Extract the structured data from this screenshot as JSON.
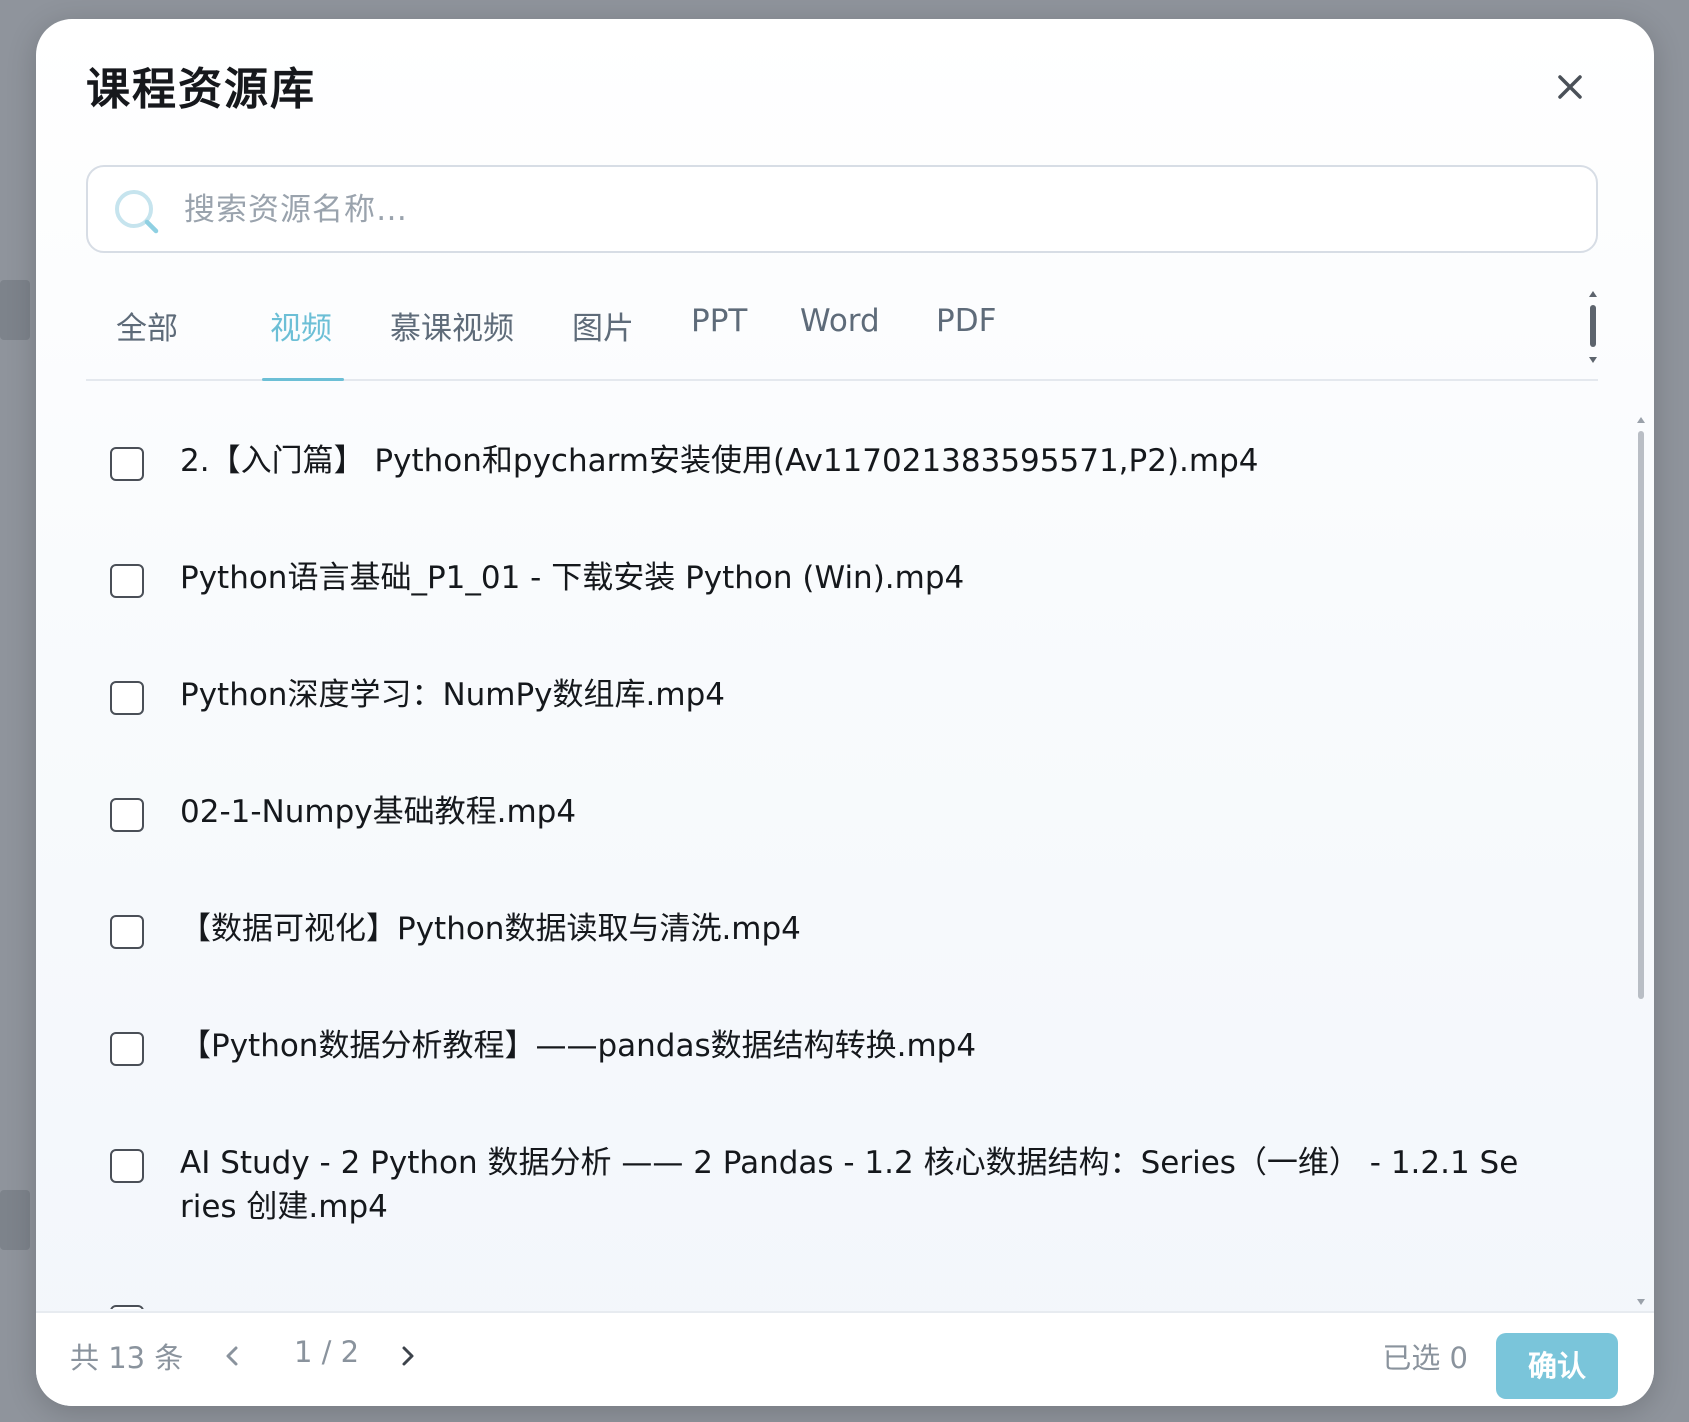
{
  "dialog": {
    "title": "课程资源库"
  },
  "search": {
    "placeholder": "搜索资源名称…"
  },
  "tabs": [
    {
      "label": "全部",
      "active": false
    },
    {
      "label": "视频",
      "active": true
    },
    {
      "label": "慕课视频",
      "active": false
    },
    {
      "label": "图片",
      "active": false
    },
    {
      "label": "PPT",
      "active": false
    },
    {
      "label": "Word",
      "active": false
    },
    {
      "label": "PDF",
      "active": false
    }
  ],
  "resources": [
    {
      "name": "2.【入门篇】 Python和pycharm安装使用(Av117021383595571,P2).mp4",
      "checked": false
    },
    {
      "name": "Python语言基础_P1_01 - 下载安装 Python (Win).mp4",
      "checked": false
    },
    {
      "name": "Python深度学习：NumPy数组库.mp4",
      "checked": false
    },
    {
      "name": "02-1-Numpy基础教程.mp4",
      "checked": false
    },
    {
      "name": "【数据可视化】Python数据读取与清洗.mp4",
      "checked": false
    },
    {
      "name": "【Python数据分析教程】——pandas数据结构转换.mp4",
      "checked": false
    },
    {
      "name": "AI Study - 2 Python 数据分析 —— 2 Pandas - 1.2 核心数据结构：Series（一维） - 1.2.1 Series 创建.mp4",
      "checked": false
    }
  ],
  "footer": {
    "total_text": "共 13 条",
    "page_text": "1 / 2",
    "selected_text": "已选 0",
    "confirm_label": "确认"
  },
  "colors": {
    "accent": "#6cbfd6",
    "confirm_button": "#7ac5da",
    "muted_text": "#8a939d"
  }
}
